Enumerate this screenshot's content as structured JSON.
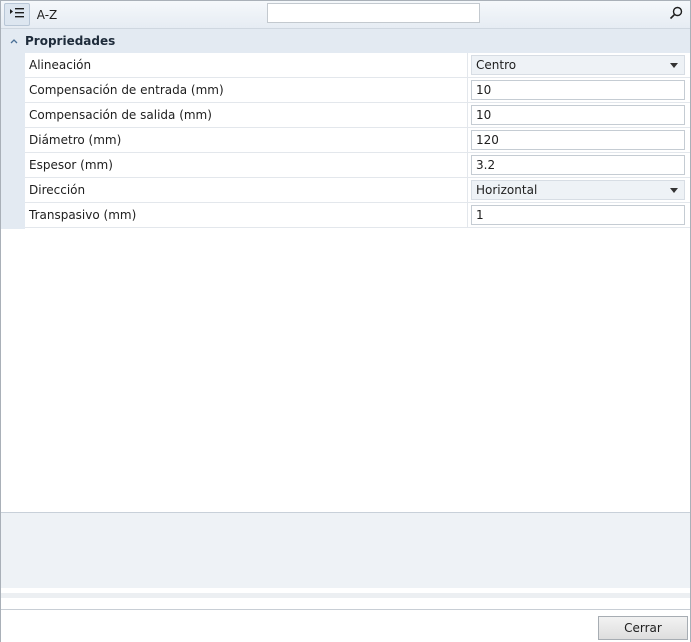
{
  "toolbar": {
    "categorized_icon": "categorized-list-icon",
    "alpha_label": "A-Z",
    "search_value": "",
    "search_icon": "search-icon"
  },
  "category": {
    "label": "Propriedades",
    "chevron_icon": "chevron-up-icon"
  },
  "properties": [
    {
      "name": "Alineación",
      "value": "Centro",
      "type": "dropdown"
    },
    {
      "name": "Compensación de entrada (mm)",
      "value": "10",
      "type": "text"
    },
    {
      "name": "Compensación de salida (mm)",
      "value": "10",
      "type": "text"
    },
    {
      "name": "Diámetro (mm)",
      "value": "120",
      "type": "text"
    },
    {
      "name": "Espesor (mm)",
      "value": "3.2",
      "type": "text"
    },
    {
      "name": "Dirección",
      "value": "Horizontal",
      "type": "dropdown"
    },
    {
      "name": "Transpasivo (mm)",
      "value": "1",
      "type": "text"
    }
  ],
  "footer": {
    "close_label": "Cerrar"
  },
  "colors": {
    "category_bg": "#e3eaf2",
    "combo_bg": "#eef2f6"
  }
}
